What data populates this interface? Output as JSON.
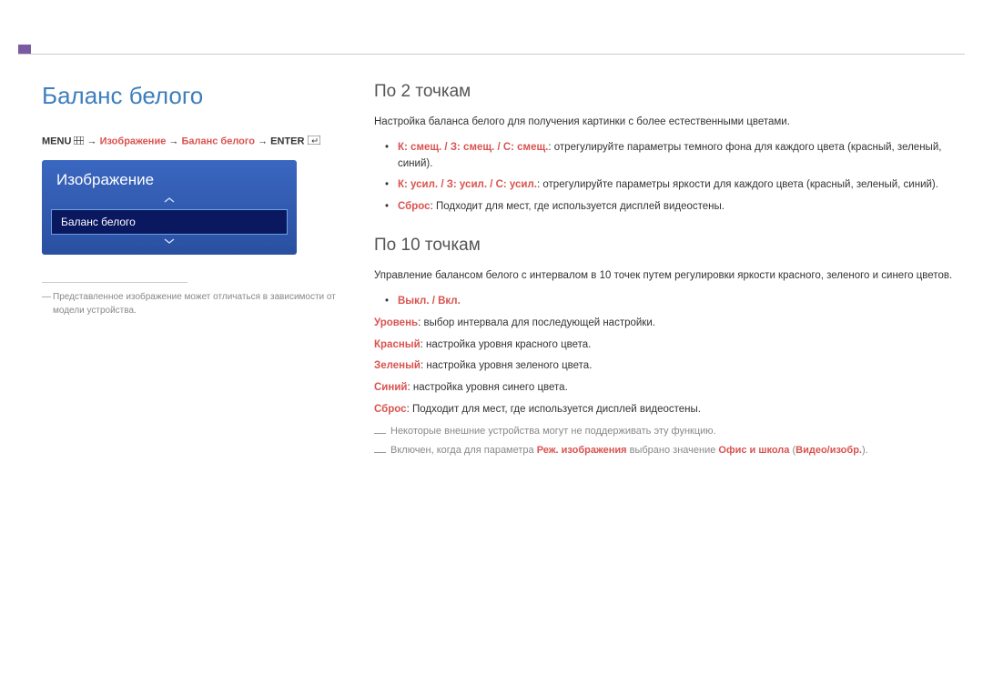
{
  "left": {
    "title": "Баланс белого",
    "breadcrumb": {
      "menu": "MENU",
      "arrow": "→",
      "p1": "Изображение",
      "p2": "Баланс белого",
      "enter": "ENTER"
    },
    "menu": {
      "title": "Изображение",
      "item": "Баланс белого"
    },
    "footnote_dash": "―",
    "footnote": "Представленное изображение может отличаться в зависимости от модели устройства."
  },
  "right": {
    "s1": {
      "heading": "По 2 точкам",
      "intro": "Настройка баланса белого для получения картинки с более естественными цветами.",
      "b1_label": "К: смещ. / З: смещ. / С: смещ.",
      "b1_text": ": отрегулируйте параметры темного фона для каждого цвета (красный, зеленый, синий).",
      "b2_label": "К: усил. / З: усил. / С: усил.",
      "b2_text": ": отрегулируйте параметры яркости для каждого цвета (красный, зеленый, синий).",
      "b3_label": "Сброс",
      "b3_text": ": Подходит для мест, где используется дисплей видеостены."
    },
    "s2": {
      "heading": "По 10 точкам",
      "intro": "Управление балансом белого с интервалом в 10 точек путем регулировки яркости красного, зеленого и синего цветов.",
      "b1": "Выкл. / Вкл.",
      "d1_label": "Уровень",
      "d1_text": ": выбор интервала для последующей настройки.",
      "d2_label": "Красный",
      "d2_text": ": настройка уровня красного цвета.",
      "d3_label": "Зеленый",
      "d3_text": ": настройка уровня зеленого цвета.",
      "d4_label": "Синий",
      "d4_text": ": настройка уровня синего цвета.",
      "d5_label": "Сброс",
      "d5_text": ": Подходит для мест, где используется дисплей видеостены.",
      "note1_dash": "―",
      "note1": "Некоторые внешние устройства могут не поддерживать эту функцию.",
      "note2_dash": "―",
      "note2_a": "Включен, когда для параметра ",
      "note2_b": "Реж. изображения",
      "note2_c": " выбрано значение ",
      "note2_d": "Офис и школа",
      "note2_e": " (",
      "note2_f": "Видео/изобр.",
      "note2_g": ")."
    }
  }
}
